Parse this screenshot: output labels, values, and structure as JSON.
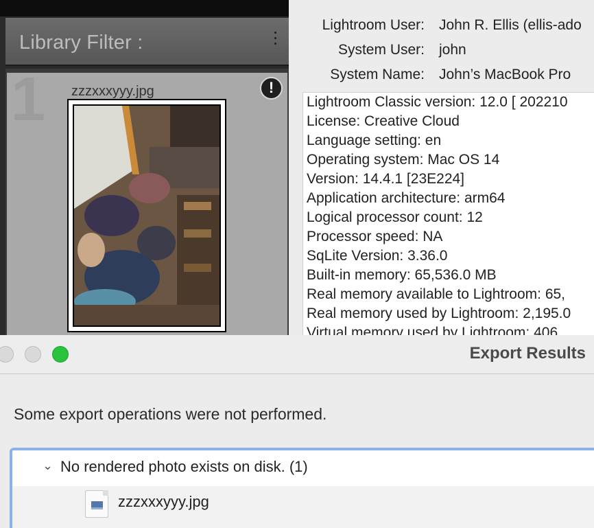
{
  "library": {
    "filter_title": "Library Filter :",
    "cell_index": "1",
    "filename": "zzzxxxyyy.jpg",
    "badge": "!"
  },
  "system_info": {
    "users": [
      {
        "label": "Lightroom User:",
        "value": "John R. Ellis (ellis-ado"
      },
      {
        "label": "System User:",
        "value": "john"
      },
      {
        "label": "System Name:",
        "value": "John’s MacBook Pro"
      }
    ],
    "lines": [
      "Lightroom Classic version: 12.0 [ 202210",
      "License: Creative Cloud",
      "Language setting: en",
      "Operating system: Mac OS 14",
      "Version: 14.4.1 [23E224]",
      "Application architecture: arm64",
      "Logical processor count: 12",
      "Processor speed: NA",
      "SqLite Version: 3.36.0",
      "Built-in memory: 65,536.0 MB",
      "Real memory available to Lightroom: 65,",
      "Real memory used by Lightroom: 2,195.0",
      "Virtual memory used by Lightroom: 406"
    ]
  },
  "dialog": {
    "title": "Export Results",
    "message": "Some export operations were not performed.",
    "group": {
      "label": "No rendered photo exists on disk. (1)",
      "expanded": true
    },
    "files": [
      "zzzxxxyyy.jpg"
    ]
  },
  "colors": {
    "zoom_button": "#2ac33c",
    "list_focus_border": "#8eb1ec"
  }
}
